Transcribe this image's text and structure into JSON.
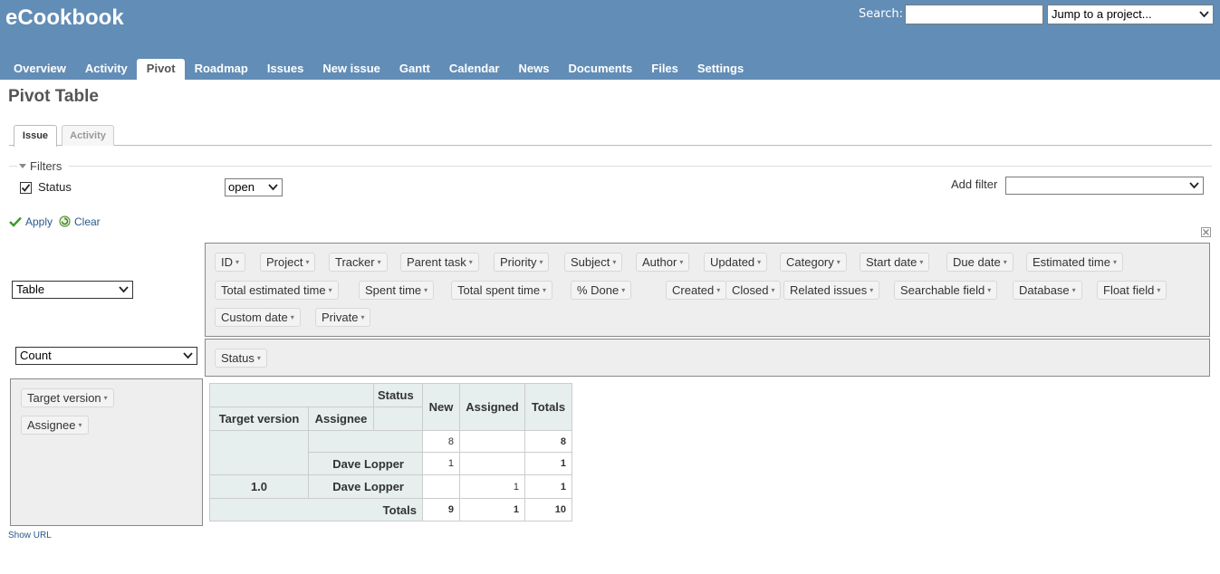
{
  "header": {
    "app_title": "eCookbook",
    "search_label": "Search:",
    "search_value": "",
    "jump_label": "Jump to a project...",
    "menu": [
      "Overview",
      "Activity",
      "Pivot",
      "Roadmap",
      "Issues",
      "New issue",
      "Gantt",
      "Calendar",
      "News",
      "Documents",
      "Files",
      "Settings"
    ],
    "selected_menu": "Pivot"
  },
  "page_title": "Pivot Table",
  "tabs": [
    "Issue",
    "Activity"
  ],
  "filters": {
    "legend": "Filters",
    "status_label": "Status",
    "status_checked": true,
    "status_operator": "open",
    "add_filter_label": "Add filter",
    "add_filter_value": "",
    "apply": "Apply",
    "clear": "Clear"
  },
  "pivot": {
    "renderer": "Table",
    "aggregator": "Count",
    "attributes": [
      "ID",
      "Project",
      "Tracker",
      "Parent task",
      "Priority",
      "Subject",
      "Author",
      "Updated",
      "Category",
      "Start date",
      "Due date",
      "Estimated time",
      "Total estimated time",
      "Spent time",
      "Total spent time",
      "% Done",
      "Created",
      "Closed",
      "Related issues",
      "Searchable field",
      "Database",
      "Float field",
      "Custom date",
      "Private"
    ],
    "col_attrs": [
      "Status"
    ],
    "row_attrs": [
      "Target version",
      "Assignee"
    ],
    "table": {
      "col_header_label": "Status",
      "row_header_1": "Target version",
      "row_header_2": "Assignee",
      "columns": [
        "New",
        "Assigned"
      ],
      "totals_label": "Totals",
      "rows": [
        {
          "version": "",
          "assignee": "",
          "values": [
            "8",
            ""
          ],
          "total": "8"
        },
        {
          "version": "",
          "assignee": "Dave Lopper",
          "values": [
            "1",
            ""
          ],
          "total": "1"
        },
        {
          "version": "1.0",
          "assignee": "Dave Lopper",
          "values": [
            "",
            "1"
          ],
          "total": "1"
        }
      ],
      "col_totals": [
        "9",
        "1"
      ],
      "grand_total": "10"
    }
  },
  "show_url": "Show URL"
}
